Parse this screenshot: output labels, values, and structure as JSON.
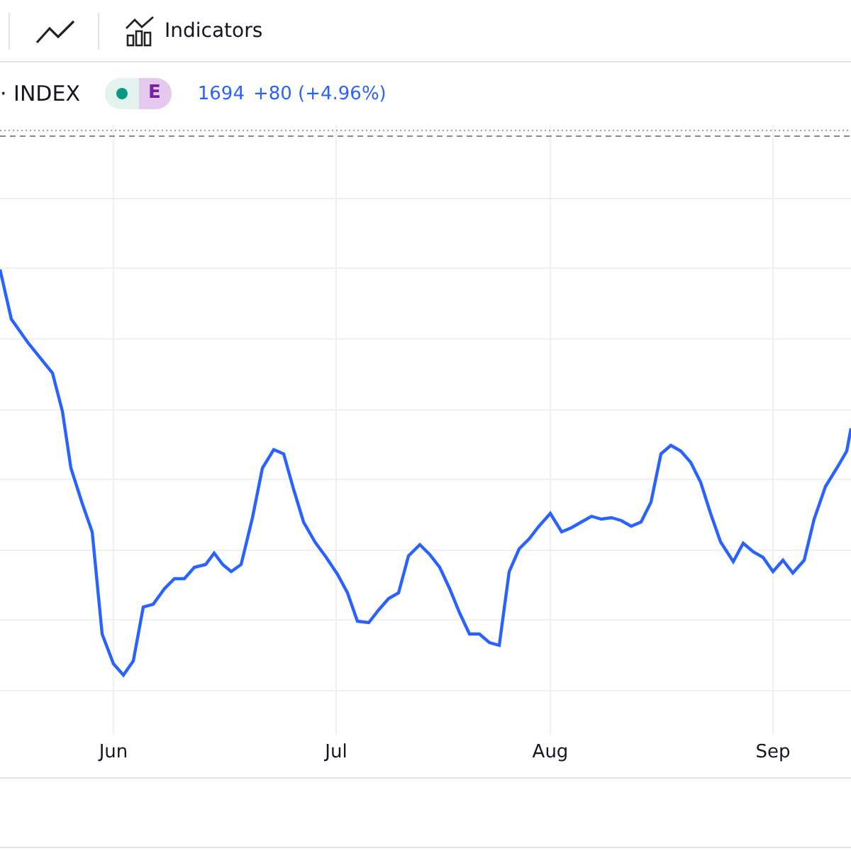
{
  "toolbar": {
    "indicators_label": "Indicators"
  },
  "legend": {
    "symbol": "· INDEX",
    "badge_letter": "E",
    "market_open": true,
    "price": "1694",
    "change": "+80 (+4.96%)"
  },
  "chart": {
    "kind": "picture",
    "x_labels": [
      "Jun",
      "Jul",
      "Aug",
      "Sep"
    ]
  }
}
